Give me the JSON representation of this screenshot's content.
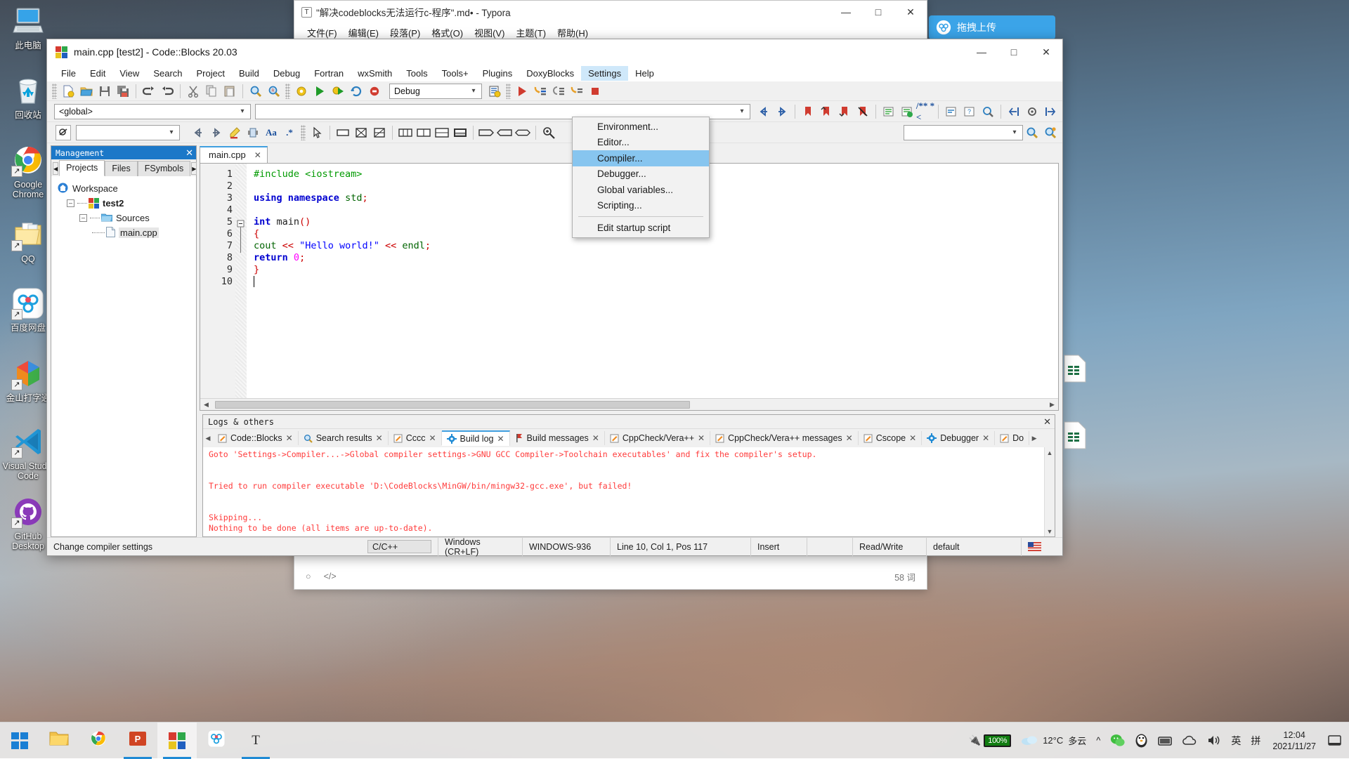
{
  "desktop": {
    "icons": [
      {
        "label": "此电脑",
        "icon": "this-pc-icon",
        "shortcut": false
      },
      {
        "label": "回收站",
        "icon": "recycle-bin-icon",
        "shortcut": false
      },
      {
        "label": "Google Chrome",
        "icon": "chrome-icon",
        "shortcut": true
      },
      {
        "label": "QQ",
        "icon": "qq-icon",
        "shortcut": true
      },
      {
        "label": "百度网盘",
        "icon": "baidu-netdisk-icon",
        "shortcut": true
      },
      {
        "label": "金山打字通",
        "icon": "kingsoft-typing-icon",
        "shortcut": true
      },
      {
        "label": "Visual Studio Code",
        "icon": "vscode-icon",
        "shortcut": true
      },
      {
        "label": "GitHub Desktop",
        "icon": "github-desktop-icon",
        "shortcut": true
      }
    ],
    "right_icons": [
      {
        "label": "拖拽上传",
        "icon": "baidu-upload-icon"
      }
    ]
  },
  "taskbar": {
    "start": "start-button",
    "items": [
      {
        "name": "file-explorer",
        "icon": "folder-icon"
      },
      {
        "name": "chrome",
        "icon": "chrome-icon"
      },
      {
        "name": "powerpoint",
        "icon": "powerpoint-icon"
      },
      {
        "name": "codeblocks",
        "icon": "codeblocks-icon"
      },
      {
        "name": "baidu-netdisk",
        "icon": "baidu-netdisk-icon"
      },
      {
        "name": "typora",
        "icon": "typora-icon"
      }
    ],
    "tray": {
      "battery": "100%",
      "weather_temp": "12°C",
      "weather_desc": "多云",
      "chevron": "^",
      "ime_lang": "英",
      "ime_mode": "拼",
      "time": "12:04",
      "date": "2021/11/27"
    }
  },
  "typora": {
    "title": "\"解决codeblocks无法运行c-程序\".md• - Typora",
    "badge": "T",
    "menu": [
      "文件(F)",
      "编辑(E)",
      "段落(P)",
      "格式(O)",
      "视图(V)",
      "主题(T)",
      "帮助(H)"
    ],
    "win_buttons": {
      "minimize": "—",
      "maximize": "□",
      "close": "✕"
    },
    "status": {
      "outline": "○",
      "source": "</>",
      "word_count": "58 词"
    }
  },
  "codeblocks": {
    "title": "main.cpp [test2] - Code::Blocks 20.03",
    "win_buttons": {
      "minimize": "—",
      "maximize": "□",
      "close": "✕"
    },
    "menubar": [
      "File",
      "Edit",
      "View",
      "Search",
      "Project",
      "Build",
      "Debug",
      "Fortran",
      "wxSmith",
      "Tools",
      "Tools+",
      "Plugins",
      "DoxyBlocks",
      "Settings",
      "Help"
    ],
    "open_menu": "Settings",
    "settings_menu": {
      "items": [
        {
          "label": "Environment...",
          "highlight": false
        },
        {
          "label": "Editor...",
          "highlight": false
        },
        {
          "label": "Compiler...",
          "highlight": true
        },
        {
          "label": "Debugger...",
          "highlight": false
        },
        {
          "label": "Global variables...",
          "highlight": false
        },
        {
          "label": "Scripting...",
          "highlight": false
        }
      ],
      "footer": {
        "label": "Edit startup script"
      }
    },
    "toolbar": {
      "build_target": "Debug",
      "scope_combo": "<global>",
      "symbol_combo": "",
      "search_combo": ""
    },
    "management": {
      "title": "Management",
      "close": "✕",
      "tabs": [
        "Projects",
        "Files",
        "FSymbols"
      ],
      "selected_tab": "Projects",
      "tree": {
        "workspace": "Workspace",
        "project": "test2",
        "folder": "Sources",
        "file": "main.cpp"
      }
    },
    "editor": {
      "tab": "main.cpp",
      "tab_close": "✕",
      "lines": [
        {
          "n": 1,
          "html": "<span class='pp'>#include &lt;iostream&gt;</span>"
        },
        {
          "n": 2,
          "html": ""
        },
        {
          "n": 3,
          "html": "<span class='k'>using namespace</span> <span class='sc'>std</span><span class='op'>;</span>"
        },
        {
          "n": 4,
          "html": ""
        },
        {
          "n": 5,
          "html": "<span class='k'>int</span> main<span class='op'>()</span>"
        },
        {
          "n": 6,
          "html": "<span class='op'>{</span>"
        },
        {
          "n": 7,
          "html": "    <span class='sc'>cout</span> <span class='op'>&lt;&lt;</span> <span class='str'>\"Hello world!\"</span> <span class='op'>&lt;&lt;</span> <span class='sc'>endl</span><span class='op'>;</span>"
        },
        {
          "n": 8,
          "html": "    <span class='k'>return</span> <span class='num'>0</span><span class='op'>;</span>"
        },
        {
          "n": 9,
          "html": "<span class='op'>}</span>"
        },
        {
          "n": 10,
          "html": ""
        }
      ]
    },
    "logs": {
      "title": "Logs &amp; others",
      "close": "✕",
      "tabs": [
        {
          "label": "Code::Blocks",
          "icon": "pencil-icon",
          "selected": false
        },
        {
          "label": "Search results",
          "icon": "magnifier-icon",
          "selected": false
        },
        {
          "label": "Cccc",
          "icon": "pencil-icon",
          "selected": false
        },
        {
          "label": "Build log",
          "icon": "gear-icon",
          "selected": true
        },
        {
          "label": "Build messages",
          "icon": "flag-icon",
          "selected": false
        },
        {
          "label": "CppCheck/Vera++",
          "icon": "pencil-icon",
          "selected": false
        },
        {
          "label": "CppCheck/Vera++ messages",
          "icon": "pencil-icon",
          "selected": false
        },
        {
          "label": "Cscope",
          "icon": "pencil-icon",
          "selected": false
        },
        {
          "label": "Debugger",
          "icon": "gear-icon",
          "selected": false
        },
        {
          "label": "Do",
          "icon": "pencil-icon",
          "selected": false
        }
      ],
      "content": "Goto 'Settings->Compiler...->Global compiler settings->GNU GCC Compiler->Toolchain executables' and fix the compiler's setup.\n\n\nTried to run compiler executable 'D:\\CodeBlocks\\MinGW/bin/mingw32-gcc.exe', but failed!\n\n\nSkipping...\nNothing to be done (all items are up-to-date).\n"
    },
    "statusbar": {
      "hint": "Change compiler settings",
      "language": "C/C++",
      "eol": "Windows (CR+LF)",
      "encoding": "WINDOWS-936",
      "position": "Line 10, Col 1, Pos 117",
      "insert_mode": "Insert",
      "blank": "",
      "rw": "Read/Write",
      "profile": "default",
      "keyboard": "us-flag-icon"
    }
  },
  "colors": {
    "accent_blue": "#1c78c8",
    "menu_highlight": "#87c5ef",
    "log_red": "#ff3b3b",
    "tab_active": "#3f9fe0"
  }
}
